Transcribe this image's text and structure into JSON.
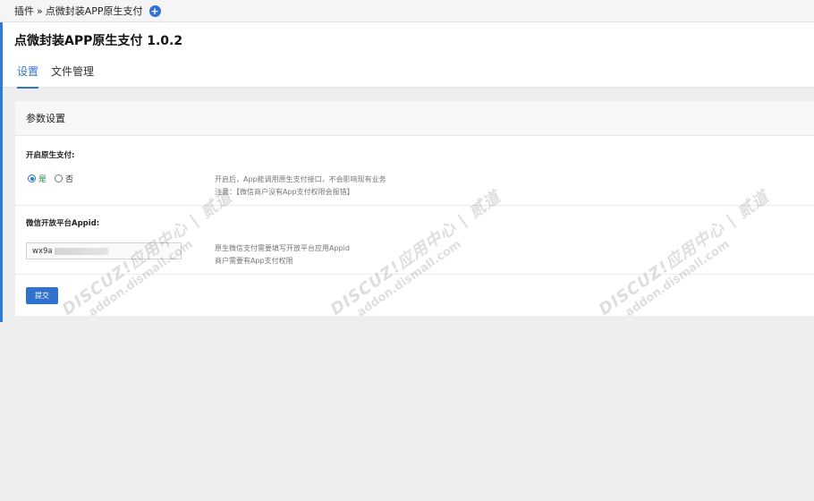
{
  "breadcrumb": {
    "root": "插件",
    "separator": "»",
    "current": "点微封装APP原生支付",
    "add_icon": "plus-circle-icon"
  },
  "header": {
    "title": "点微封装APP原生支付 1.0.2",
    "tabs": [
      {
        "label": "设置",
        "active": true
      },
      {
        "label": "文件管理",
        "active": false
      }
    ]
  },
  "panel": {
    "title": "参数设置",
    "native_pay": {
      "label": "开启原生支付:",
      "options": [
        "是",
        "否"
      ],
      "selected": "是",
      "help": [
        "开启后，App能调用原生支付接口，不会影响现有业务",
        "注意：【微信商户没有App支付权限会报错】"
      ]
    },
    "appid": {
      "label": "微信开放平台Appid:",
      "value": "wx9a",
      "help": [
        "原生微信支付需要填写开放平台应用Appid",
        "商户需要有App支付权限"
      ]
    },
    "submit_label": "提交"
  },
  "watermark": {
    "line1": "DISCUZ!应用中心 | 贰道",
    "line2": "addon.dismall.com"
  },
  "colors": {
    "accent": "#2f72cf",
    "selected_option": "#1d8f3a",
    "background": "#eeeeee"
  }
}
